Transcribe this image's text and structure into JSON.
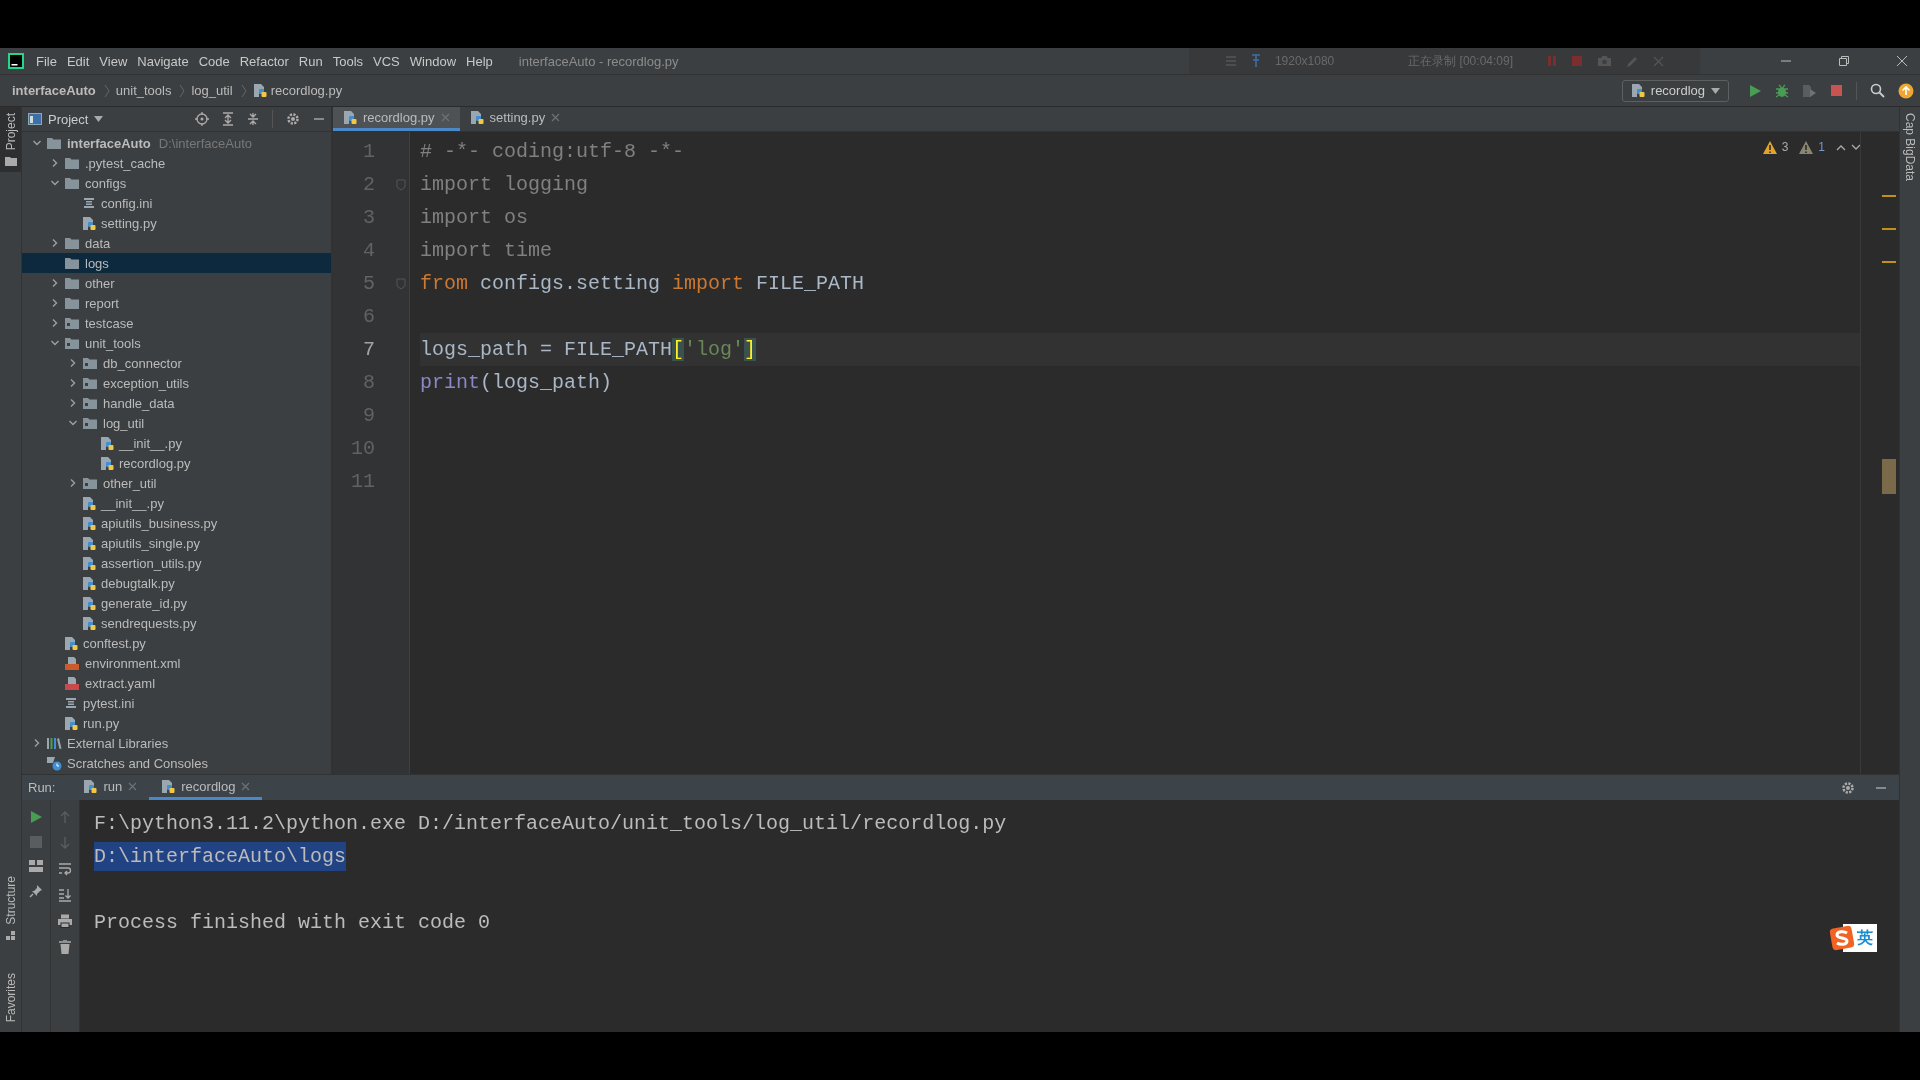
{
  "menu_bar": {
    "items": [
      "File",
      "Edit",
      "View",
      "Navigate",
      "Code",
      "Refactor",
      "Run",
      "Tools",
      "VCS",
      "Window",
      "Help"
    ],
    "title": "interfaceAuto - recordlog.py"
  },
  "recorder": {
    "resolution": "1920x1080",
    "status": "正在录制 [00:04:09]"
  },
  "breadcrumbs": [
    "interfaceAuto",
    "unit_tools",
    "log_util",
    "recordlog.py"
  ],
  "run_config": "recordlog",
  "left_strip": {
    "top": {
      "label": "Project",
      "selected": true
    },
    "bottom": [
      {
        "label": "Structure",
        "selected": false
      },
      {
        "label": "Favorites",
        "selected": false
      }
    ]
  },
  "right_strip": "Cap BigData",
  "project_panel": {
    "title": "Project",
    "tree": [
      {
        "name": "interfaceAuto",
        "hint": "D:\\interfaceAuto",
        "kind": "folder",
        "expanded": true,
        "selected": false,
        "children": [
          {
            "name": ".pytest_cache",
            "kind": "folder",
            "expanded": false,
            "selected": false
          },
          {
            "name": "configs",
            "kind": "folder",
            "expanded": true,
            "selected": false,
            "children": [
              {
                "name": "config.ini",
                "kind": "ini",
                "selected": false
              },
              {
                "name": "setting.py",
                "kind": "py",
                "selected": false
              }
            ]
          },
          {
            "name": "data",
            "kind": "folder",
            "expanded": false,
            "selected": false
          },
          {
            "name": "logs",
            "kind": "folder",
            "selected": true
          },
          {
            "name": "other",
            "kind": "folder",
            "expanded": false,
            "selected": false
          },
          {
            "name": "report",
            "kind": "folder",
            "expanded": false,
            "selected": false
          },
          {
            "name": "testcase",
            "kind": "package",
            "expanded": false,
            "selected": false
          },
          {
            "name": "unit_tools",
            "kind": "package",
            "expanded": true,
            "selected": false,
            "children": [
              {
                "name": "db_connector",
                "kind": "package",
                "expanded": false,
                "selected": false
              },
              {
                "name": "exception_utils",
                "kind": "package",
                "expanded": false,
                "selected": false
              },
              {
                "name": "handle_data",
                "kind": "package",
                "expanded": false,
                "selected": false
              },
              {
                "name": "log_util",
                "kind": "package",
                "expanded": true,
                "selected": false,
                "children": [
                  {
                    "name": "__init__.py",
                    "kind": "py",
                    "selected": false
                  },
                  {
                    "name": "recordlog.py",
                    "kind": "py",
                    "selected": false
                  }
                ]
              },
              {
                "name": "other_util",
                "kind": "package",
                "expanded": false,
                "selected": false
              },
              {
                "name": "__init__.py",
                "kind": "py",
                "selected": false
              },
              {
                "name": "apiutils_business.py",
                "kind": "py",
                "selected": false
              },
              {
                "name": "apiutils_single.py",
                "kind": "py",
                "selected": false
              },
              {
                "name": "assertion_utils.py",
                "kind": "py",
                "selected": false
              },
              {
                "name": "debugtalk.py",
                "kind": "py",
                "selected": false
              },
              {
                "name": "generate_id.py",
                "kind": "py",
                "selected": false
              },
              {
                "name": "sendrequests.py",
                "kind": "py",
                "selected": false
              }
            ]
          },
          {
            "name": "conftest.py",
            "kind": "py",
            "selected": false
          },
          {
            "name": "environment.xml",
            "kind": "xml",
            "selected": false
          },
          {
            "name": "extract.yaml",
            "kind": "yaml",
            "selected": false
          },
          {
            "name": "pytest.ini",
            "kind": "ini",
            "selected": false
          },
          {
            "name": "run.py",
            "kind": "py",
            "selected": false
          }
        ]
      },
      {
        "name": "External Libraries",
        "kind": "library",
        "expanded": false,
        "selected": false
      },
      {
        "name": "Scratches and Consoles",
        "kind": "scratches",
        "selected": false
      }
    ]
  },
  "editor": {
    "tabs": [
      {
        "label": "recordlog.py",
        "selected": true
      },
      {
        "label": "setting.py",
        "selected": false
      }
    ],
    "warnings": "3",
    "weak_warnings": "1",
    "lines": [
      {
        "number": "1",
        "current": false,
        "tokens": [
          {
            "text": "# -*- coding:utf-8 -*-",
            "kind": "comment"
          }
        ]
      },
      {
        "number": "2",
        "current": false,
        "fold": true,
        "tokens": [
          {
            "text": "import",
            "kind": "unused"
          },
          {
            "text": " logging",
            "kind": "unused"
          }
        ]
      },
      {
        "number": "3",
        "current": false,
        "tokens": [
          {
            "text": "import",
            "kind": "unused"
          },
          {
            "text": " os",
            "kind": "unused"
          }
        ]
      },
      {
        "number": "4",
        "current": false,
        "tokens": [
          {
            "text": "import",
            "kind": "unused"
          },
          {
            "text": " time",
            "kind": "unused"
          }
        ]
      },
      {
        "number": "5",
        "current": false,
        "fold": true,
        "tokens": [
          {
            "text": "from",
            "kind": "keyword"
          },
          {
            "text": " configs.setting ",
            "kind": "plain"
          },
          {
            "text": "import",
            "kind": "keyword"
          },
          {
            "text": " FILE_PATH",
            "kind": "plain"
          }
        ]
      },
      {
        "number": "6",
        "current": false
      },
      {
        "number": "7",
        "current": true,
        "tokens": [
          {
            "text": "logs_path = FILE_PATH",
            "kind": "plain"
          },
          {
            "text": "[",
            "kind": "bracket"
          },
          {
            "text": "'log'",
            "kind": "string"
          },
          {
            "text": "]",
            "kind": "bracket"
          }
        ]
      },
      {
        "number": "8",
        "current": false,
        "tokens": [
          {
            "text": "print",
            "kind": "builtin"
          },
          {
            "text": "(logs_path)",
            "kind": "plain"
          }
        ]
      },
      {
        "number": "9",
        "current": false
      },
      {
        "number": "10",
        "current": false
      },
      {
        "number": "11",
        "current": false
      }
    ]
  },
  "run_panel": {
    "label": "Run:",
    "tabs": [
      {
        "label": "run",
        "selected": false
      },
      {
        "label": "recordlog",
        "selected": true
      }
    ],
    "output": [
      {
        "kind": "command",
        "text": "F:\\python3.11.2\\python.exe D:/interfaceAuto/unit_tools/log_util/recordlog.py",
        "selected": false
      },
      {
        "kind": "output",
        "text": "D:\\interfaceAuto\\logs",
        "selected": true
      },
      {
        "kind": "exit",
        "text": "Process finished with exit code 0",
        "selected": false
      }
    ]
  },
  "ime_indicator": "英"
}
